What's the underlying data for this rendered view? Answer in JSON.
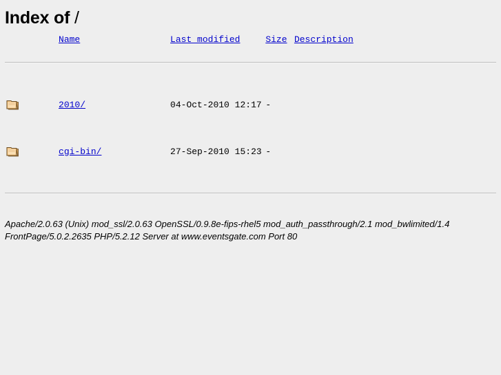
{
  "page": {
    "title_prefix": "Index of ",
    "title_path": "/",
    "background_color": "#eeeeee",
    "link_color": "#0000cc",
    "rule_color": "#bdbdbd"
  },
  "table": {
    "headers": {
      "icon": "",
      "name": "Name",
      "last_modified": "Last modified",
      "size": "Size",
      "description": "Description"
    },
    "rows": [
      {
        "icon": "folder-icon",
        "name": "2010/",
        "last_modified": "04-Oct-2010 12:17",
        "size": "-",
        "description": ""
      },
      {
        "icon": "folder-icon",
        "name": "cgi-bin/",
        "last_modified": "27-Sep-2010 15:23",
        "size": "-",
        "description": ""
      }
    ]
  },
  "footer": {
    "line1": "Apache/2.0.63 (Unix) mod_ssl/2.0.63 OpenSSL/0.9.8e-fips-rhel5 mod_auth_passthrough/2.1 mod_bwlimited/1.4",
    "line2": "FrontPage/5.0.2.2635 PHP/5.2.12 Server at www.eventsgate.com Port 80"
  }
}
